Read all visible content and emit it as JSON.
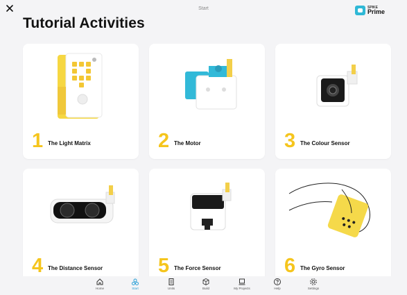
{
  "header": {
    "title": "Start",
    "brand_small": "SPIKE",
    "brand_name": "Prime"
  },
  "page": {
    "heading": "Tutorial Activities"
  },
  "cards": [
    {
      "number": "1",
      "title": "The Light Matrix"
    },
    {
      "number": "2",
      "title": "The Motor"
    },
    {
      "number": "3",
      "title": "The Colour Sensor"
    },
    {
      "number": "4",
      "title": "The Distance Sensor"
    },
    {
      "number": "5",
      "title": "The Force Sensor"
    },
    {
      "number": "6",
      "title": "The Gyro Sensor"
    }
  ],
  "nav": [
    {
      "label": "Home",
      "icon": "home-icon"
    },
    {
      "label": "Start",
      "icon": "start-icon",
      "active": true
    },
    {
      "label": "Units",
      "icon": "units-icon"
    },
    {
      "label": "Build",
      "icon": "build-icon"
    },
    {
      "label": "My Projects",
      "icon": "projects-icon"
    },
    {
      "label": "Help",
      "icon": "help-icon"
    },
    {
      "label": "Settings",
      "icon": "settings-icon"
    }
  ],
  "colors": {
    "accent": "#2a9fd6",
    "number_yellow": "#f5c51d",
    "background": "#f4f4f6"
  }
}
